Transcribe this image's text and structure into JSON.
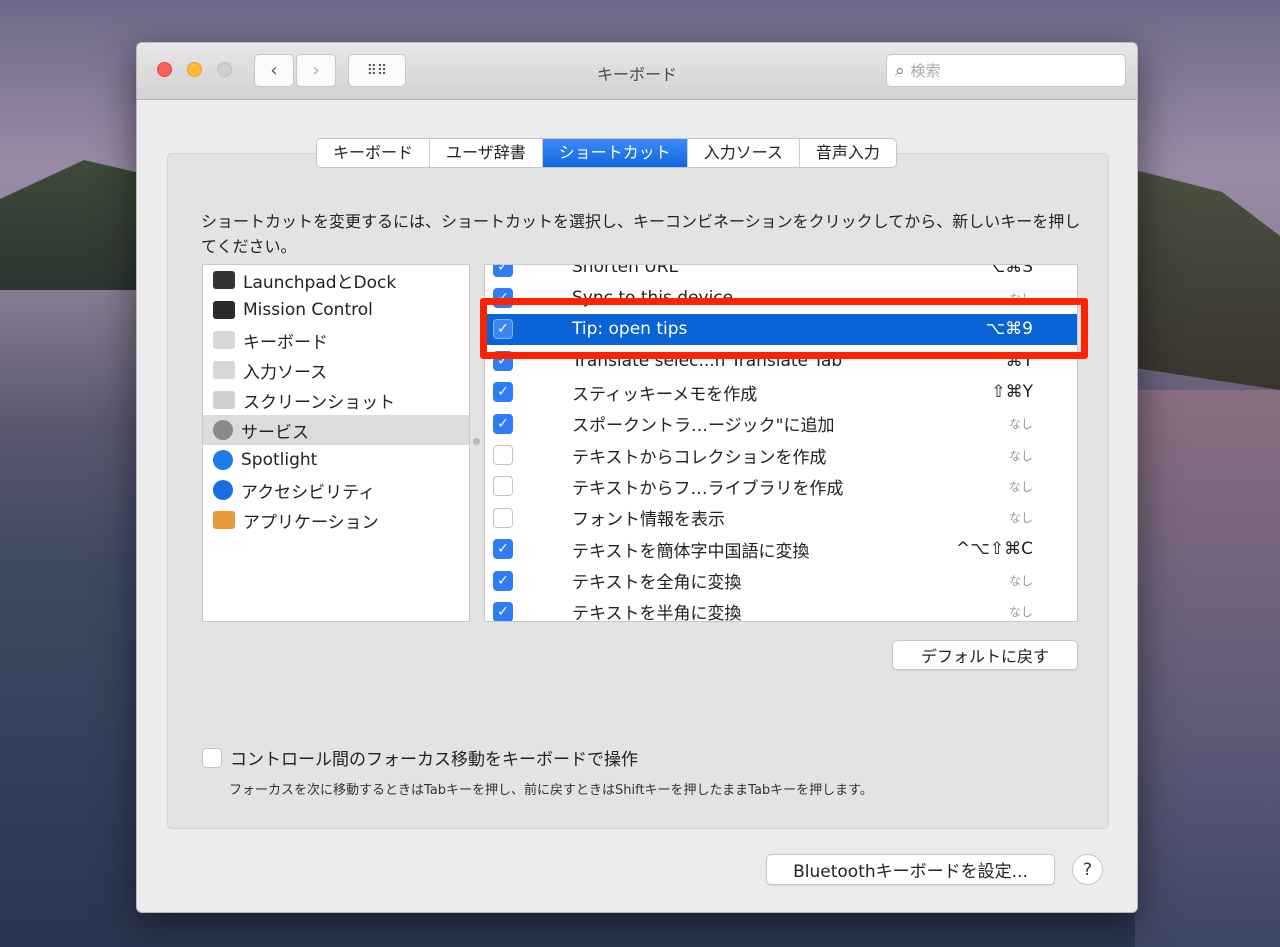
{
  "window": {
    "title": "キーボード",
    "search_placeholder": "検索"
  },
  "tabs": [
    {
      "label": "キーボード"
    },
    {
      "label": "ユーザ辞書"
    },
    {
      "label": "ショートカット",
      "active": true
    },
    {
      "label": "入力ソース"
    },
    {
      "label": "音声入力"
    }
  ],
  "instructions": "ショートカットを変更するには、ショートカットを選択し、キーコンビネーションをクリックしてから、新しいキーを押してください。",
  "categories": [
    {
      "label": "LaunchpadとDock",
      "icon": "launchpad-dock-icon",
      "color": "#333333"
    },
    {
      "label": "Mission Control",
      "icon": "mission-control-icon",
      "color": "#2a2a2a"
    },
    {
      "label": "キーボード",
      "icon": "keyboard-icon",
      "color": "#d8d8d8"
    },
    {
      "label": "入力ソース",
      "icon": "input-source-icon",
      "color": "#d8d8d8"
    },
    {
      "label": "スクリーンショット",
      "icon": "screenshot-icon",
      "color": "#cfcfcf"
    },
    {
      "label": "サービス",
      "icon": "gear-icon",
      "color": "#8a8a8a",
      "selected": true
    },
    {
      "label": "Spotlight",
      "icon": "spotlight-icon",
      "color": "#1e7be8"
    },
    {
      "label": "アクセシビリティ",
      "icon": "accessibility-icon",
      "color": "#1a6fe0"
    },
    {
      "label": "アプリケーション",
      "icon": "app-store-icon",
      "color": "#e59a3a"
    }
  ],
  "shortcuts": [
    {
      "label": "Shorten URL",
      "key": "⌥⌘S",
      "checked": true
    },
    {
      "label": "Sync to this device",
      "key": "なし",
      "none": true,
      "checked": true
    },
    {
      "label": "Tip: open tips",
      "key": "⌥⌘9",
      "checked": true,
      "selected": true
    },
    {
      "label": "Translate selec...n Translate Tab",
      "key": "^⌘T",
      "checked": true
    },
    {
      "label": "スティッキーメモを作成",
      "key": "⇧⌘Y",
      "checked": true
    },
    {
      "label": "スポークントラ…ージック\"に追加",
      "key": "なし",
      "none": true,
      "checked": true
    },
    {
      "label": "テキストからコレクションを作成",
      "key": "なし",
      "none": true,
      "checked": false
    },
    {
      "label": "テキストからフ…ライブラリを作成",
      "key": "なし",
      "none": true,
      "checked": false
    },
    {
      "label": "フォント情報を表示",
      "key": "なし",
      "none": true,
      "checked": false
    },
    {
      "label": "テキストを簡体字中国語に変換",
      "key": "^⌥⇧⌘C",
      "checked": true
    },
    {
      "label": "テキストを全角に変換",
      "key": "なし",
      "none": true,
      "checked": true
    },
    {
      "label": "テキストを半角に変換",
      "key": "なし",
      "none": true,
      "checked": true
    }
  ],
  "restore_defaults": "デフォルトに戻す",
  "focus_option": {
    "label": "コントロール間のフォーカス移動をキーボードで操作",
    "checked": false,
    "note": "フォーカスを次に移動するときはTabキーを押し、前に戻すときはShiftキーを押したままTabキーを押します。"
  },
  "bluetooth_button": "Bluetoothキーボードを設定...",
  "help_label": "?",
  "highlight_color": "#ff2200",
  "accent_color": "#0a64d8"
}
